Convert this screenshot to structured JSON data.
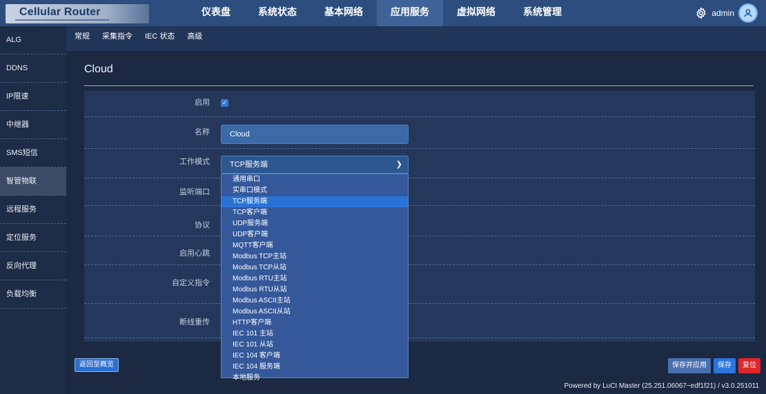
{
  "header": {
    "brand": "Cellular Router",
    "nav": [
      "仪表盘",
      "系统状态",
      "基本网络",
      "应用服务",
      "虚拟网络",
      "系统管理"
    ],
    "active_nav": "应用服务",
    "user": "admin"
  },
  "sidebar": {
    "items": [
      "ALG",
      "DDNS",
      "IP限速",
      "中继器",
      "SMS短信",
      "智管物联",
      "远程服务",
      "定位服务",
      "反向代理",
      "负载均衡"
    ],
    "active": "智管物联"
  },
  "tabs": [
    "常规",
    "采集指令",
    "IEC 状态",
    "高级"
  ],
  "panel": {
    "title": "Cloud",
    "labels": {
      "enable": "启用",
      "name": "名称",
      "mode": "工作模式",
      "listen_port": "监听端口",
      "protocol": "协议",
      "heartbeat": "启用心跳",
      "custom_cmd": "自定义指令",
      "resume": "断线重传"
    },
    "enable_checked": true,
    "name_value": "Cloud",
    "mode_value": "TCP服务端",
    "mode_options": [
      "通用串口",
      "实串口模式",
      "TCP服务端",
      "TCP客户端",
      "UDP服务端",
      "UDP客户端",
      "MQTT客户端",
      "Modbus TCP主站",
      "Modbus TCP从站",
      "Modbus RTU主站",
      "Modbus RTU从站",
      "Modbus ASCII主站",
      "Modbus ASCII从站",
      "HTTP客户端",
      "IEC 101 主站",
      "IEC 101 从站",
      "IEC 104 客户端",
      "IEC 104 服务端",
      "本地服务"
    ]
  },
  "buttons": {
    "back": "返回至概览",
    "save_apply": "保存并应用",
    "save": "保存",
    "reset": "复位"
  },
  "footer": "Powered by LuCI Master (25.251.06067~edf1f21) / v3.0.251011",
  "colors": {
    "accent": "#2d74de",
    "danger": "#e0262a",
    "background": "#1b2942"
  }
}
